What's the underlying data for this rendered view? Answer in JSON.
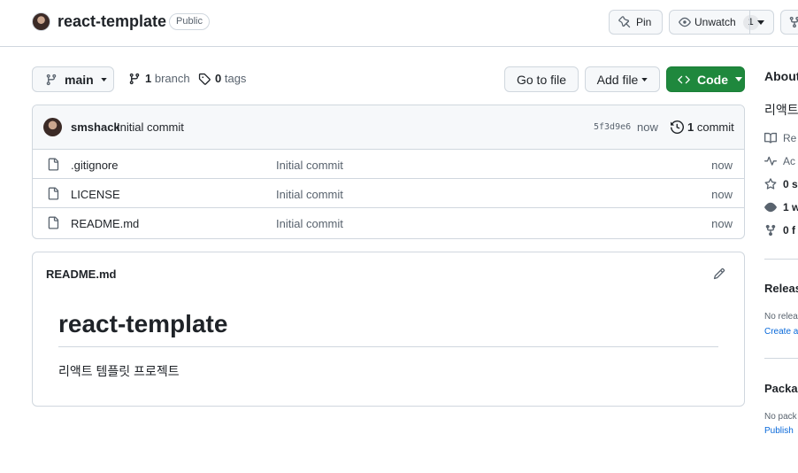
{
  "repo": {
    "name": "react-template",
    "visibility": "Public",
    "pin_label": "Pin",
    "watch_label": "Unwatch",
    "watch_count": "1"
  },
  "toolbar": {
    "branch": "main",
    "branch_count": "1",
    "branch_label": "branch",
    "tag_count": "0",
    "tag_label": "tags",
    "go_to_file": "Go to file",
    "add_file": "Add file",
    "code": "Code"
  },
  "latest_commit": {
    "author": "smshack",
    "message": "Initial commit",
    "sha": "5f3d9e6",
    "time": "now",
    "count": "1",
    "count_label": "commit"
  },
  "files": [
    {
      "name": ".gitignore",
      "message": "Initial commit",
      "time": "now"
    },
    {
      "name": "LICENSE",
      "message": "Initial commit",
      "time": "now"
    },
    {
      "name": "README.md",
      "message": "Initial commit",
      "time": "now"
    }
  ],
  "readme": {
    "filename": "README.md",
    "title": "react-template",
    "description": "리액트 템플릿 프로젝트"
  },
  "sidebar": {
    "about": "About",
    "description": "리액트",
    "readme": "Re",
    "activity": "Ac",
    "stars": "0 s",
    "watching": "1 w",
    "forks": "0 f",
    "releases_heading": "Releas",
    "releases_text": "No relea",
    "releases_link": "Create a",
    "packages_heading": "Packa",
    "packages_text": "No pack",
    "packages_link": "Publish"
  }
}
